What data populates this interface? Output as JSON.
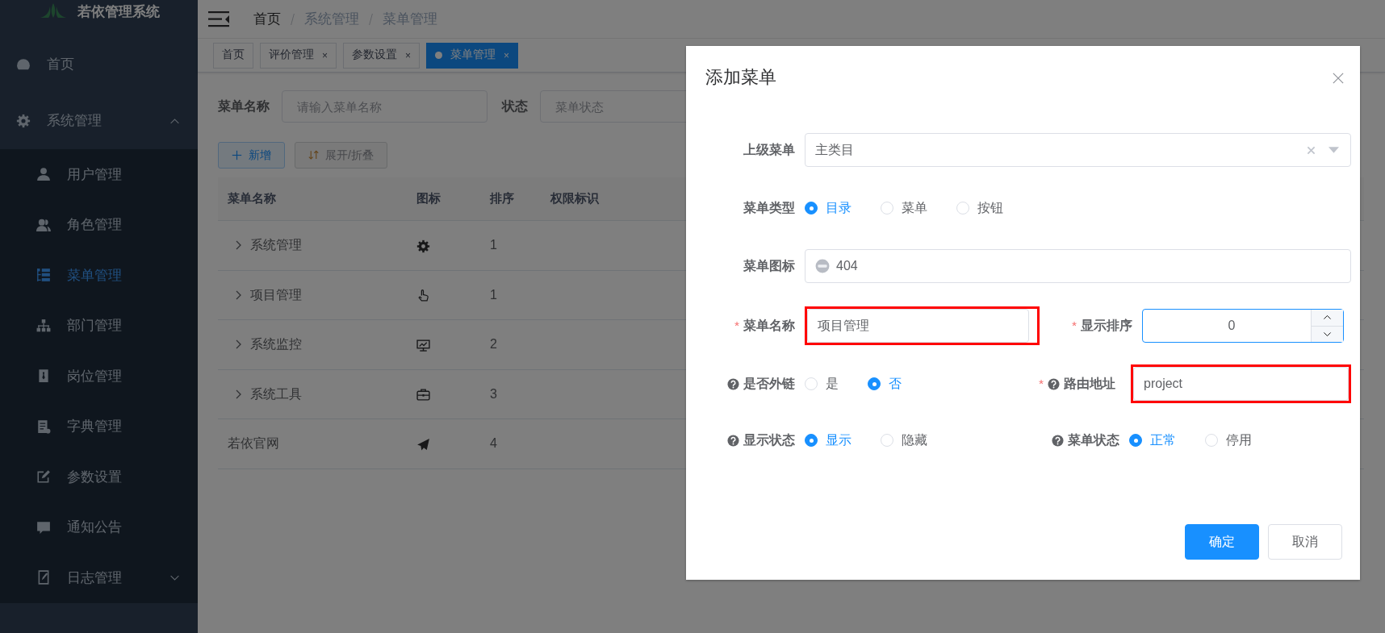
{
  "sidebar": {
    "logo": "若依管理系统",
    "items": [
      {
        "label": "首页",
        "kind": "link",
        "selected": false
      },
      {
        "label": "系统管理",
        "kind": "group",
        "expanded": true,
        "children": [
          {
            "label": "用户管理",
            "kind": "link",
            "selected": false
          },
          {
            "label": "角色管理",
            "kind": "link",
            "selected": false
          },
          {
            "label": "菜单管理",
            "kind": "link",
            "selected": true
          },
          {
            "label": "部门管理",
            "kind": "link",
            "selected": false
          },
          {
            "label": "岗位管理",
            "kind": "link",
            "selected": false
          },
          {
            "label": "字典管理",
            "kind": "link",
            "selected": false
          },
          {
            "label": "参数设置",
            "kind": "link",
            "selected": false
          },
          {
            "label": "通知公告",
            "kind": "link",
            "selected": false
          },
          {
            "label": "日志管理",
            "kind": "group",
            "expanded": false
          }
        ]
      }
    ]
  },
  "breadcrumb": [
    {
      "label": "首页"
    },
    {
      "label": "系统管理"
    },
    {
      "label": "菜单管理"
    }
  ],
  "tags": [
    {
      "label": "首页",
      "selected": false
    },
    {
      "label": "评价管理",
      "selected": false,
      "close": "×"
    },
    {
      "label": "参数设置",
      "selected": false,
      "close": "×"
    },
    {
      "label": "菜单管理",
      "selected": true,
      "close": "×"
    }
  ],
  "search": [
    {
      "label": "菜单名称",
      "placeholder": "请输入菜单名称"
    },
    {
      "label": "状态",
      "placeholder": "菜单状态"
    }
  ],
  "toolbar": [
    {
      "label": "新增",
      "kind": "primary"
    },
    {
      "label": "展开/折叠",
      "kind": "info"
    }
  ],
  "table": {
    "columns": [
      "菜单名称",
      "图标",
      "排序",
      "权限标识"
    ],
    "rows": [
      {
        "name": "系统管理",
        "expandable": true,
        "sort": "1"
      },
      {
        "name": "项目管理",
        "expandable": true,
        "sort": "1"
      },
      {
        "name": "系统监控",
        "expandable": true,
        "sort": "2"
      },
      {
        "name": "系统工具",
        "expandable": true,
        "sort": "3"
      },
      {
        "name": "若依官网",
        "expandable": false,
        "sort": "4"
      }
    ]
  },
  "dialog": {
    "title": "添加菜单",
    "rows": [
      [
        {
          "kind": "select",
          "label": "上级菜单",
          "value": "主类目"
        }
      ],
      [
        {
          "kind": "radio",
          "label": "菜单类型",
          "options": [
            {
              "label": "目录",
              "selected": true
            },
            {
              "label": "菜单",
              "selected": false
            },
            {
              "label": "按钮",
              "selected": false
            }
          ]
        }
      ],
      [
        {
          "kind": "icon-input",
          "label": "菜单图标",
          "value": "404"
        }
      ],
      [
        {
          "kind": "text",
          "label": "菜单名称",
          "required_mark": "*",
          "value": "项目管理",
          "highlighted": true
        },
        {
          "kind": "number",
          "label": "显示排序",
          "required_mark": "*",
          "value": "0",
          "focused": true
        }
      ],
      [
        {
          "kind": "radio",
          "label": "是否外链",
          "help": true,
          "options": [
            {
              "label": "是",
              "selected": false
            },
            {
              "label": "否",
              "selected": true
            }
          ]
        },
        {
          "kind": "text",
          "label": "路由地址",
          "required_mark": "*",
          "help": true,
          "value": "project",
          "highlighted": true
        }
      ],
      [
        {
          "kind": "radio",
          "label": "显示状态",
          "help": true,
          "options": [
            {
              "label": "显示",
              "selected": true
            },
            {
              "label": "隐藏",
              "selected": false
            }
          ]
        },
        {
          "kind": "radio",
          "label": "菜单状态",
          "help": true,
          "options": [
            {
              "label": "正常",
              "selected": true
            },
            {
              "label": "停用",
              "selected": false
            }
          ]
        }
      ]
    ],
    "buttons": [
      {
        "label": "确定",
        "kind": "primary"
      },
      {
        "label": "取消",
        "kind": "default"
      }
    ]
  }
}
